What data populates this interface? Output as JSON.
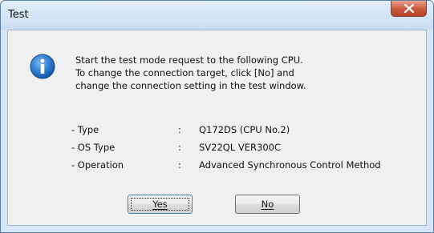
{
  "window": {
    "title": "Test"
  },
  "message": {
    "lines": [
      "Start the test mode request to the following CPU.",
      "To change the connection target, click [No] and",
      "change the connection setting in the test window."
    ]
  },
  "properties": [
    {
      "label": "- Type",
      "separator": ":",
      "value": "Q172DS (CPU No.2)"
    },
    {
      "label": "- OS Type",
      "separator": ":",
      "value": "SV22QL  VER300C"
    },
    {
      "label": "- Operation",
      "separator": ":",
      "value": "Advanced Synchronous Control Method"
    }
  ],
  "buttons": {
    "yes": "Yes",
    "no": "No"
  },
  "icons": {
    "close": "close-icon",
    "info": "information-icon"
  },
  "colors": {
    "accent": "#1f6fc5",
    "close": "#c9573c"
  }
}
